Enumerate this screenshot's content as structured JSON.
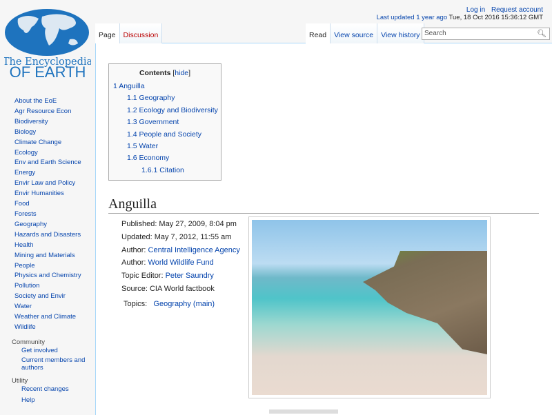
{
  "logo": {
    "line1": "The Encyclopedia",
    "line2": "OF EARTH"
  },
  "personal": {
    "login": "Log in",
    "request": "Request account"
  },
  "last_updated": {
    "label": "Last updated",
    "ago": "1 year ago",
    "date": "Tue, 18 Oct 2016 15:36:12 GMT"
  },
  "tabs": {
    "page": "Page",
    "discussion": "Discussion",
    "read": "Read",
    "view_source": "View source",
    "view_history": "View history"
  },
  "search": {
    "placeholder": "Search"
  },
  "sidebar": {
    "items": [
      "About the EoE",
      "Agr Resource Econ",
      "Biodiversity",
      "Biology",
      "Climate Change",
      "Ecology",
      "Env and Earth Science",
      "Energy",
      "Envir Law and Policy",
      "Envir Humanities",
      "Food",
      "Forests",
      "Geography",
      "Hazards and Disasters",
      "Health",
      "Mining and Materials",
      "People",
      "Physics and Chemistry",
      "Pollution",
      "Society and Envir",
      "Water",
      "Weather and Climate",
      "Wildlife"
    ],
    "community": {
      "title": "Community",
      "items": [
        "Get involved",
        "Current members and authors"
      ]
    },
    "utility": {
      "title": "Utility",
      "items": [
        "Recent changes",
        "Help"
      ]
    }
  },
  "toc": {
    "title": "Contents",
    "hide": "hide",
    "items": [
      [
        "1",
        "Anguilla"
      ],
      [
        "1.1",
        "Geography"
      ],
      [
        "1.2",
        "Ecology and Biodiversity"
      ],
      [
        "1.3",
        "Government"
      ],
      [
        "1.4",
        "People and Society"
      ],
      [
        "1.5",
        "Water"
      ],
      [
        "1.6",
        "Economy"
      ],
      [
        "1.6.1",
        "Citation"
      ]
    ]
  },
  "article": {
    "title": "Anguilla",
    "published": "Published: May 27, 2009, 8:04 pm",
    "updated": "Updated: May 7, 2012, 11:55 am",
    "author_label": "Author:",
    "author1": "Central Intelligence Agency",
    "author2": "World Wildlife Fund",
    "editor_label": "Topic Editor:",
    "editor": "Peter Saundry",
    "source": "Source: CIA World factbook",
    "topics_label": "Topics:",
    "topics": "Geography (main)"
  }
}
